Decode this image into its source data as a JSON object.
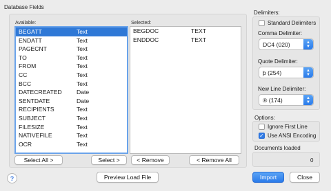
{
  "database_fields": {
    "title": "Database Fields",
    "available_label": "Available:",
    "selected_label": "Selected:",
    "available": [
      {
        "name": "BEGATT",
        "type": "Text",
        "selected": true
      },
      {
        "name": "ENDATT",
        "type": "Text"
      },
      {
        "name": "PAGECNT",
        "type": "Text"
      },
      {
        "name": "TO",
        "type": "Text"
      },
      {
        "name": "FROM",
        "type": "Text"
      },
      {
        "name": "CC",
        "type": "Text"
      },
      {
        "name": "BCC",
        "type": "Text"
      },
      {
        "name": "DATECREATED",
        "type": "Date"
      },
      {
        "name": "SENTDATE",
        "type": "Date"
      },
      {
        "name": "RECIPIENTS",
        "type": "Text"
      },
      {
        "name": "SUBJECT",
        "type": "Text"
      },
      {
        "name": "FILESIZE",
        "type": "Text"
      },
      {
        "name": "NATIVEFILE",
        "type": "Text"
      },
      {
        "name": "OCR",
        "type": "Text"
      }
    ],
    "selected": [
      {
        "name": "BEGDOC",
        "type": "TEXT"
      },
      {
        "name": "ENDDOC",
        "type": "TEXT"
      }
    ],
    "buttons": {
      "select_all": "Select All >",
      "select": "Select >",
      "remove": "< Remove",
      "remove_all": "< Remove All"
    }
  },
  "delimiters": {
    "title": "Delimiters:",
    "standard_label": "Standard Delimiters",
    "standard_checked": false,
    "comma_label": "Comma Delimiter:",
    "comma_value": "DC4 (020)",
    "quote_label": "Quote Delimiter:",
    "quote_value": "þ (254)",
    "newline_label": "New Line Delimiter:",
    "newline_value": "® (174)"
  },
  "options": {
    "title": "Options:",
    "ignore_first_line": "Ignore First Line",
    "ignore_first_line_checked": false,
    "use_ansi": "Use ANSI Encoding",
    "use_ansi_checked": true
  },
  "documents_loaded": {
    "title": "Documents loaded",
    "count": "0"
  },
  "footer": {
    "help": "?",
    "preview": "Preview Load File",
    "import": "Import",
    "close": "Close"
  }
}
